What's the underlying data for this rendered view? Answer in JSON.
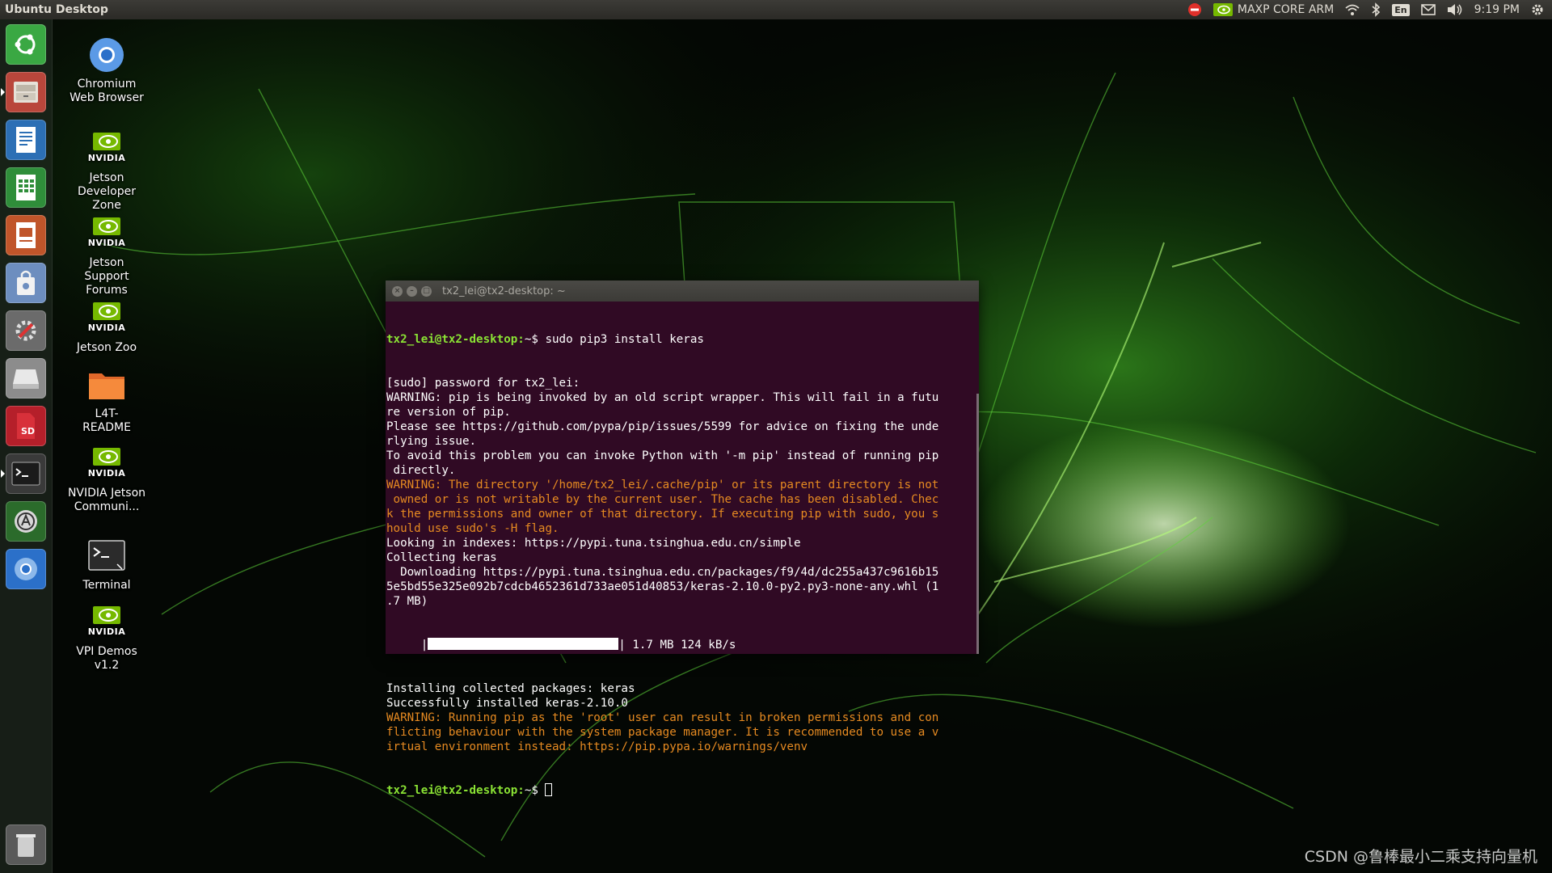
{
  "panel": {
    "title": "Ubuntu Desktop",
    "power_mode": "MAXP CORE ARM",
    "keyboard_layout": "En",
    "clock": "9:19 PM",
    "icons": [
      "no-entry-icon",
      "nvidia-icon",
      "wifi-icon",
      "bluetooth-icon",
      "mail-icon",
      "volume-icon",
      "gear-icon"
    ]
  },
  "launcher": {
    "items": [
      {
        "name": "dash-home",
        "icon": "ubuntu-logo-icon",
        "color": "#3aa843"
      },
      {
        "name": "files",
        "icon": "file-cabinet-icon",
        "color": "#b9463b"
      },
      {
        "name": "writer",
        "icon": "document-icon",
        "color": "#2c6fb5"
      },
      {
        "name": "calc",
        "icon": "spreadsheet-icon",
        "color": "#2f8e3a"
      },
      {
        "name": "impress",
        "icon": "presentation-icon",
        "color": "#c0552a"
      },
      {
        "name": "software",
        "icon": "shopping-bag-icon",
        "color": "#6d8ebf"
      },
      {
        "name": "settings",
        "icon": "wrench-gear-icon",
        "color": "#6b6b6b"
      },
      {
        "name": "drive",
        "icon": "hard-drive-icon",
        "color": "#8c8c8c"
      },
      {
        "name": "sd-card",
        "icon": "sd-card-icon",
        "color": "#b51f2a",
        "label": "SD"
      },
      {
        "name": "terminal",
        "icon": "terminal-icon",
        "color": "#3a3a3a"
      },
      {
        "name": "updater",
        "icon": "update-icon",
        "color": "#2b6b2b"
      },
      {
        "name": "chromium",
        "icon": "chromium-icon",
        "color": "#2b70c9"
      },
      {
        "name": "trash",
        "icon": "trash-icon",
        "color": "#5a5a5a"
      }
    ]
  },
  "desktop": {
    "icons": [
      {
        "label": "Chromium Web Browser",
        "icon": "chromium-icon"
      },
      {
        "label": "Jetson Developer Zone",
        "icon": "nvidia-logo-icon",
        "brand": "NVIDIA"
      },
      {
        "label": "Jetson Support Forums",
        "icon": "nvidia-logo-icon",
        "brand": "NVIDIA"
      },
      {
        "label": "Jetson Zoo",
        "icon": "nvidia-logo-icon",
        "brand": "NVIDIA"
      },
      {
        "label": "L4T-README",
        "icon": "folder-icon"
      },
      {
        "label": "NVIDIA Jetson Communi...",
        "icon": "nvidia-logo-icon",
        "brand": "NVIDIA"
      },
      {
        "label": "Terminal",
        "icon": "terminal-icon"
      },
      {
        "label": "VPI Demos v1.2",
        "icon": "nvidia-logo-icon",
        "brand": "NVIDIA"
      }
    ]
  },
  "terminal": {
    "title": "tx2_lei@tx2-desktop: ~",
    "prompt": "tx2_lei@tx2-desktop:",
    "prompt_suffix": "~$ ",
    "command": "sudo pip3 install keras",
    "lines": [
      {
        "t": "[sudo] password for tx2_lei:",
        "c": "normal"
      },
      {
        "t": "WARNING: pip is being invoked by an old script wrapper. This will fail in a futu",
        "c": "normal"
      },
      {
        "t": "re version of pip.",
        "c": "normal"
      },
      {
        "t": "Please see https://github.com/pypa/pip/issues/5599 for advice on fixing the unde",
        "c": "normal"
      },
      {
        "t": "rlying issue.",
        "c": "normal"
      },
      {
        "t": "To avoid this problem you can invoke Python with '-m pip' instead of running pip",
        "c": "normal"
      },
      {
        "t": " directly.",
        "c": "normal"
      },
      {
        "t": "WARNING: The directory '/home/tx2_lei/.cache/pip' or its parent directory is not",
        "c": "warn"
      },
      {
        "t": " owned or is not writable by the current user. The cache has been disabled. Chec",
        "c": "warn"
      },
      {
        "t": "k the permissions and owner of that directory. If executing pip with sudo, you s",
        "c": "warn"
      },
      {
        "t": "hould use sudo's -H flag.",
        "c": "warn"
      },
      {
        "t": "Looking in indexes: https://pypi.tuna.tsinghua.edu.cn/simple",
        "c": "normal"
      },
      {
        "t": "Collecting keras",
        "c": "normal"
      },
      {
        "t": "  Downloading https://pypi.tuna.tsinghua.edu.cn/packages/f9/4d/dc255a437c9616b15",
        "c": "normal"
      },
      {
        "t": "5e5bd55e325e092b7cdcb4652361d733ae051d40853/keras-2.10.0-py2.py3-none-any.whl (1",
        "c": "normal"
      },
      {
        "t": ".7 MB)",
        "c": "normal"
      }
    ],
    "progress": {
      "prefix": "     |",
      "suffix": "| 1.7 MB 124 kB/s",
      "fraction": 1.0
    },
    "lines_after": [
      {
        "t": "Installing collected packages: keras",
        "c": "normal"
      },
      {
        "t": "Successfully installed keras-2.10.0",
        "c": "normal"
      },
      {
        "t": "WARNING: Running pip as the 'root' user can result in broken permissions and con",
        "c": "warn"
      },
      {
        "t": "flicting behaviour with the system package manager. It is recommended to use a v",
        "c": "warn"
      },
      {
        "t": "irtual environment instead: https://pip.pypa.io/warnings/venv",
        "c": "warn"
      }
    ]
  },
  "watermark": "CSDN @鲁棒最小二乘支持向量机"
}
